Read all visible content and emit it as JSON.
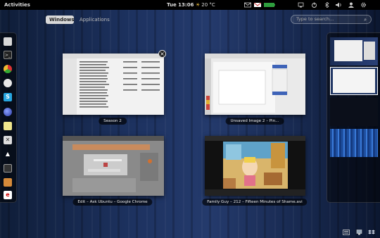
{
  "topbar": {
    "activities": "Activities",
    "clock": "Tue 13:06",
    "weather": {
      "icon": "sun-icon",
      "temperature": "20 °C"
    },
    "tray_icons": [
      "email-icon",
      "gmail-icon",
      "battery-icon",
      "network-icon",
      "power-icon",
      "bluetooth-icon",
      "volume-icon",
      "user-icon",
      "gear-icon"
    ]
  },
  "view_tabs": {
    "windows": "Windows",
    "applications": "Applications"
  },
  "search": {
    "placeholder": "Type to search..."
  },
  "dash": {
    "apps": [
      "files-icon",
      "terminal-icon",
      "chrome-icon",
      "pidgin-icon",
      "skype-icon",
      "firefox-icon",
      "notes-icon",
      "inkscape-icon",
      "vlc-icon",
      "video-editor-icon",
      "media-player-icon",
      "debian-icon"
    ]
  },
  "windows": [
    {
      "caption": "Season 2"
    },
    {
      "caption": "Unsaved Image 2 – Pin..."
    },
    {
      "caption": "Edit – Ask Ubuntu – Google Chrome"
    },
    {
      "caption": "Family Guy – 212 – Fifteen Minutes of Shame.avi"
    }
  ],
  "workspaces": [
    "workspace-1",
    "workspace-2",
    "workspace-3",
    "workspace-4"
  ],
  "bottom_tray": [
    "keyboard-icon",
    "network-tray-icon",
    "dropbox-icon"
  ]
}
